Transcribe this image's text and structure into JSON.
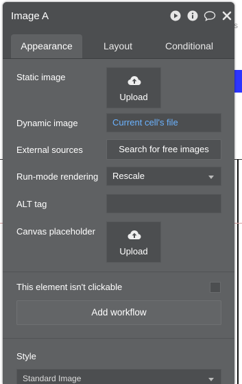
{
  "panel": {
    "title": "Image A",
    "header_icons": [
      "play-icon",
      "info-icon",
      "comment-icon",
      "close-icon"
    ],
    "tabs": [
      {
        "label": "Appearance",
        "active": true
      },
      {
        "label": "Layout",
        "active": false
      },
      {
        "label": "Conditional",
        "active": false
      }
    ]
  },
  "appearance": {
    "static_image": {
      "label": "Static image",
      "upload_label": "Upload"
    },
    "dynamic_image": {
      "label": "Dynamic image",
      "value": "Current cell's file",
      "value_color": "#6bb3ff"
    },
    "external_sources": {
      "label": "External sources",
      "button_label": "Search for free images"
    },
    "run_mode": {
      "label": "Run-mode rendering",
      "selected": "Rescale"
    },
    "alt_tag": {
      "label": "ALT tag",
      "value": ""
    },
    "canvas_placeholder": {
      "label": "Canvas placeholder",
      "upload_label": "Upload"
    },
    "clickable": {
      "label": "This element isn't clickable",
      "checked": false
    },
    "add_workflow_label": "Add workflow",
    "style": {
      "label": "Style",
      "selected": "Standard Image"
    }
  },
  "colors": {
    "panel_bg": "#5f6163",
    "header_bg": "#4c4e50",
    "accent_link": "#6bb3ff"
  }
}
